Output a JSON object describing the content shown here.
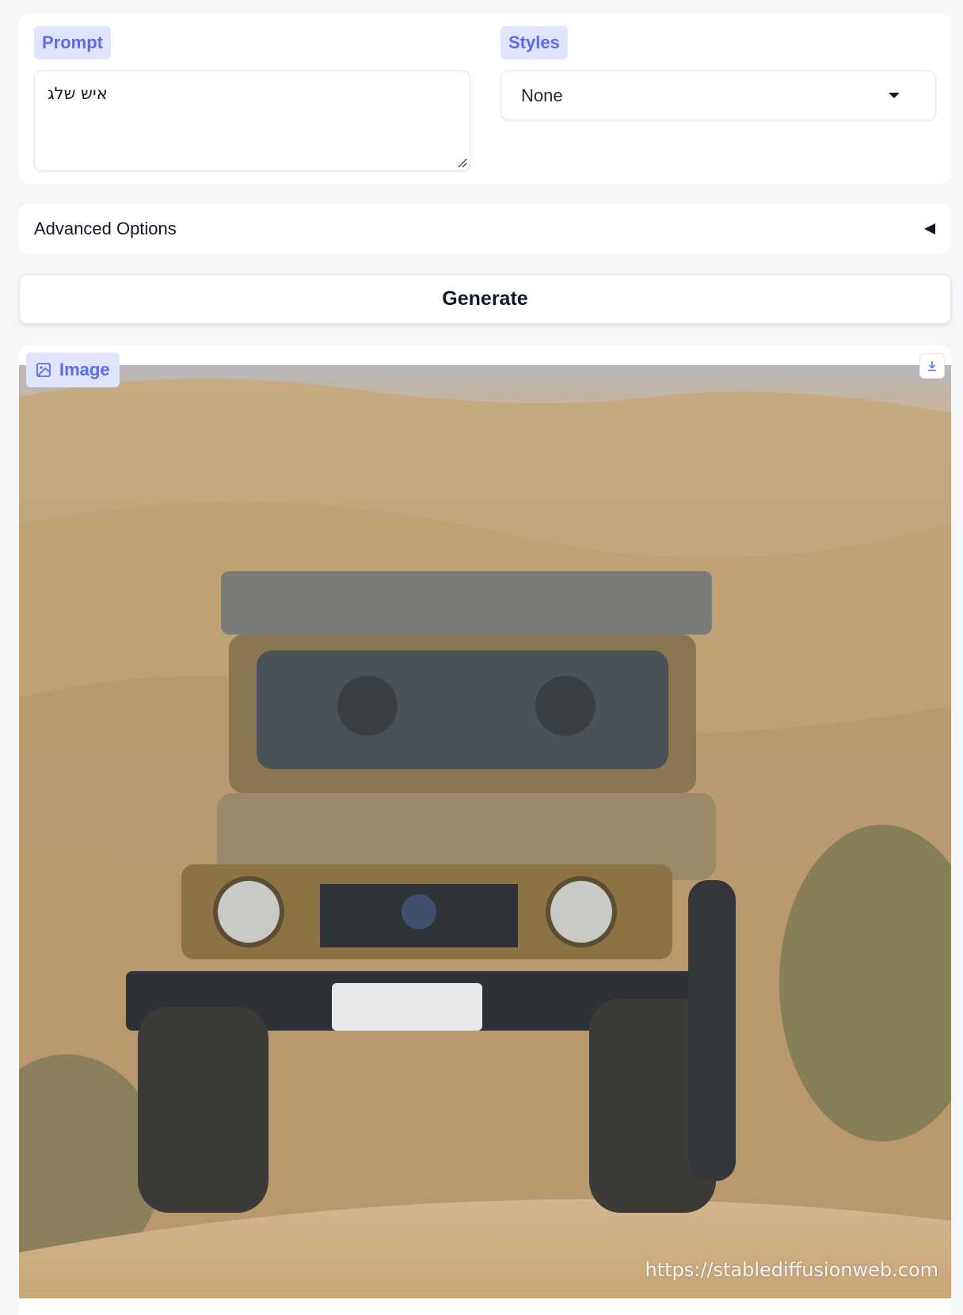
{
  "prompt": {
    "label": "Prompt",
    "value": "איש שלג"
  },
  "styles": {
    "label": "Styles",
    "selected": "None"
  },
  "advanced": {
    "label": "Advanced Options"
  },
  "generate": {
    "label": "Generate"
  },
  "output": {
    "label": "Image",
    "watermark": "https://stablediffusionweb.com",
    "image_description_icon": "image-icon",
    "download_icon": "download-icon"
  },
  "colors": {
    "accent": "#5b6bf0",
    "chip_bg": "#e0e4fd",
    "page_bg": "#f6f7f9"
  }
}
